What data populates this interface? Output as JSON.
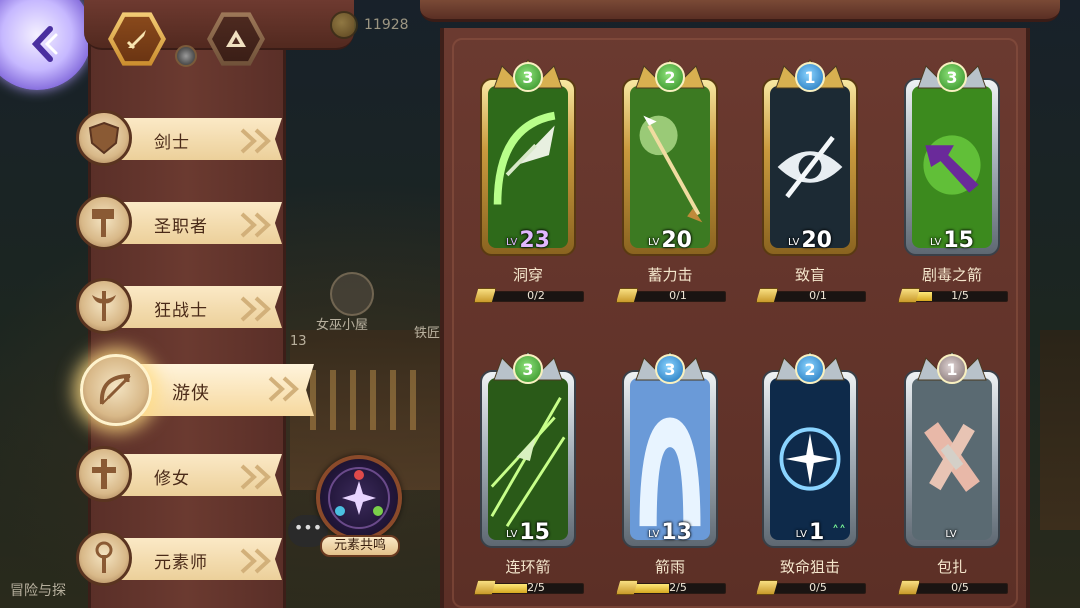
{
  "background": {
    "label_witch_hut": "女巫小屋",
    "label_partial_right": "铁匠",
    "label_partial_left": "13",
    "label_bottom_left": "冒险与探"
  },
  "top": {
    "coin_value": "11928"
  },
  "sidebar": {
    "classes": [
      {
        "label": "剑士",
        "icon": "shield-icon",
        "selected": false
      },
      {
        "label": "圣职者",
        "icon": "hammer-icon",
        "selected": false
      },
      {
        "label": "狂战士",
        "icon": "axe-icon",
        "selected": false
      },
      {
        "label": "游侠",
        "icon": "bow-icon",
        "selected": true
      },
      {
        "label": "修女",
        "icon": "cross-icon",
        "selected": false
      },
      {
        "label": "元素师",
        "icon": "staff-icon",
        "selected": false
      }
    ],
    "resonance_label": "元素共鸣",
    "chat_dots": "•••"
  },
  "skills": [
    {
      "name": "洞穿",
      "tier": "3",
      "level_prefix": "LV",
      "level": "23",
      "progress_text": "0/2",
      "progress": 0.0,
      "frame": "gold",
      "gem": "green",
      "art": "arrowhead-swirl"
    },
    {
      "name": "蓄力击",
      "tier": "2",
      "level_prefix": "LV",
      "level": "20",
      "progress_text": "0/1",
      "progress": 0.0,
      "frame": "gold",
      "gem": "green",
      "art": "charged-arrow"
    },
    {
      "name": "致盲",
      "tier": "1",
      "level_prefix": "LV",
      "level": "20",
      "progress_text": "0/1",
      "progress": 0.0,
      "frame": "gold",
      "gem": "blue",
      "art": "slashed-eye"
    },
    {
      "name": "剧毒之箭",
      "tier": "3",
      "level_prefix": "LV",
      "level": "15",
      "progress_text": "1/5",
      "progress": 0.2,
      "frame": "silver",
      "gem": "green",
      "art": "poison-arrow"
    },
    {
      "name": "连环箭",
      "tier": "3",
      "level_prefix": "LV",
      "level": "15",
      "progress_text": "2/5",
      "progress": 0.4,
      "frame": "silver",
      "gem": "green",
      "art": "chain-arrows"
    },
    {
      "name": "箭雨",
      "tier": "3",
      "level_prefix": "LV",
      "level": "13",
      "progress_text": "2/5",
      "progress": 0.4,
      "frame": "silver",
      "gem": "blue",
      "art": "arrow-rain"
    },
    {
      "name": "致命狙击",
      "tier": "2",
      "level_prefix": "LV",
      "level": "1",
      "progress_text": "0/5",
      "progress": 0.0,
      "frame": "silver",
      "gem": "blue",
      "art": "crosshair-star",
      "upgradable": true
    },
    {
      "name": "包扎",
      "tier": "1",
      "level_prefix": "LV",
      "level": "",
      "progress_text": "0/5",
      "progress": 0.0,
      "frame": "silver",
      "gem": "gray",
      "art": "bandage"
    }
  ],
  "colors": {
    "board": "#6b3a30",
    "tab": "#fbe9c6",
    "gold_frame": "#c99a3e",
    "silver_frame": "#a8b2bb",
    "progress_fill": "#ffe97a"
  }
}
